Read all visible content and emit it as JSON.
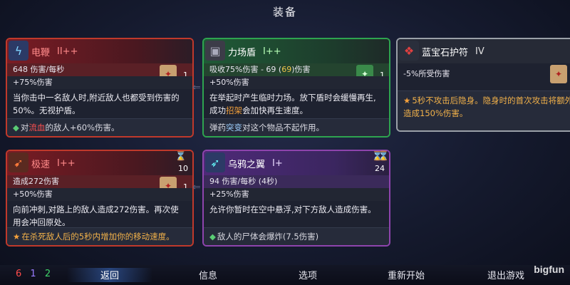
{
  "title": "装备",
  "cards": [
    {
      "name": "电鞭",
      "level": "II++",
      "icon": "whip-icon",
      "stat1": "648 伤害/每秒",
      "stat2": "+75%伤害",
      "scroll_count": "1",
      "desc": "当你击中一名敌人时,附近敌人也都受到伤害的50%。无视护盾。",
      "footer_prefix": "对",
      "footer_highlight": "流血",
      "footer_suffix": "的敌人+60%伤害。"
    },
    {
      "name": "力场盾",
      "level": "I++",
      "icon": "shield-icon",
      "stat1_a": "吸收75%伤害 - 69 (",
      "stat1_hl": "69",
      "stat1_b": ")伤害",
      "stat2": "+50%伤害",
      "scroll_count": "1",
      "desc_a": "在举起时产生临时力场。放下盾时会缓慢再生,成功",
      "desc_hl": "招架",
      "desc_b": "会加快再生速度。",
      "footer_prefix": "弹药",
      "footer_highlight": "突变",
      "footer_suffix": "对这个物品不起作用。"
    },
    {
      "name": "蓝宝石护符",
      "level": "IV",
      "icon": "amulet-icon",
      "stat1": "-5%所受伤害",
      "scroll_count": "1",
      "footer": "5秒不攻击后隐身。隐身时的首次攻击将额外造成150%伤害。"
    },
    {
      "name": "极速",
      "level": "I++",
      "icon": "dash-icon",
      "timer": "10",
      "stat1": "造成272伤害",
      "stat2": "+50%伤害",
      "scroll_count": "1",
      "desc": "向前冲刺,对路上的敌人造成272伤害。再次使用会冲回原处。",
      "footer": "在杀死敌人后的5秒内增加你的移动速度。"
    },
    {
      "name": "乌鸦之翼",
      "level": "I+",
      "icon": "wing-icon",
      "timer": "24",
      "stat1": "94 伤害/每秒 (4秒)",
      "stat2": "+25%伤害",
      "desc": "允许你暂时在空中悬浮,对下方敌人造成伤害。",
      "footer": "敌人的尸体会爆炸(7.5伤害)"
    }
  ],
  "bottom": {
    "stat_red": "6",
    "stat_purple": "1",
    "stat_green": "2",
    "menu": [
      "返回",
      "信息",
      "选项",
      "重新开始",
      "退出游戏"
    ]
  },
  "watermark": "bigfun"
}
